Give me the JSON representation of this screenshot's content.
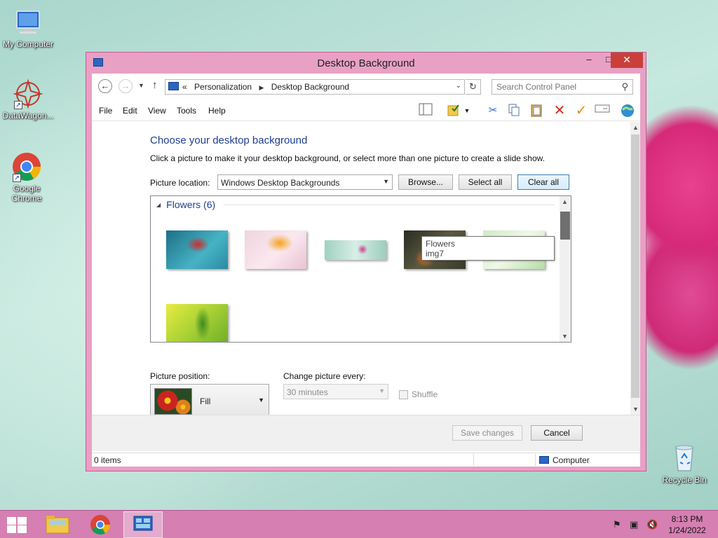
{
  "desktop": {
    "icons": [
      {
        "label": "My Computer"
      },
      {
        "label": "DataWagon..."
      },
      {
        "label": "Google Chrome"
      },
      {
        "label": "Recycle Bin"
      }
    ]
  },
  "window": {
    "title": "Desktop Background",
    "min_glyph": "–",
    "max_glyph": "□",
    "close_glyph": "✕"
  },
  "address": {
    "overflow": "«",
    "crumbs": [
      "Personalization",
      "Desktop Background"
    ],
    "search_placeholder": "Search Control Panel"
  },
  "menu": [
    "File",
    "Edit",
    "View",
    "Tools",
    "Help"
  ],
  "toolbar_icons": [
    "layout-icon",
    "properties-icon",
    "cut-icon",
    "copy-icon",
    "paste-icon",
    "delete-icon",
    "check-icon",
    "rename-icon",
    "globe-icon"
  ],
  "content": {
    "heading": "Choose your desktop background",
    "description": "Click a picture to make it your desktop background, or select more than one picture to create a slide show.",
    "picture_location_label": "Picture location:",
    "picture_location_value": "Windows Desktop Backgrounds",
    "browse": "Browse...",
    "select_all": "Select all",
    "clear_all": "Clear all",
    "group_title": "Flowers (6)",
    "tooltip": {
      "line1": "Flowers",
      "line2": "img7"
    },
    "picture_position_label": "Picture position:",
    "picture_position_value": "Fill",
    "change_every_label": "Change picture every:",
    "change_every_value": "30 minutes",
    "shuffle": "Shuffle"
  },
  "footer": {
    "save": "Save changes",
    "cancel": "Cancel"
  },
  "status": {
    "items": "0 items",
    "location": "Computer"
  },
  "taskbar": {
    "time": "8:13 PM",
    "date": "1/24/2022"
  },
  "colors": {
    "accent_title": "#1e3f8f",
    "window_frame": "#e8a0c4",
    "close_button": "#c9403b",
    "taskbar": "#d57fb2"
  }
}
